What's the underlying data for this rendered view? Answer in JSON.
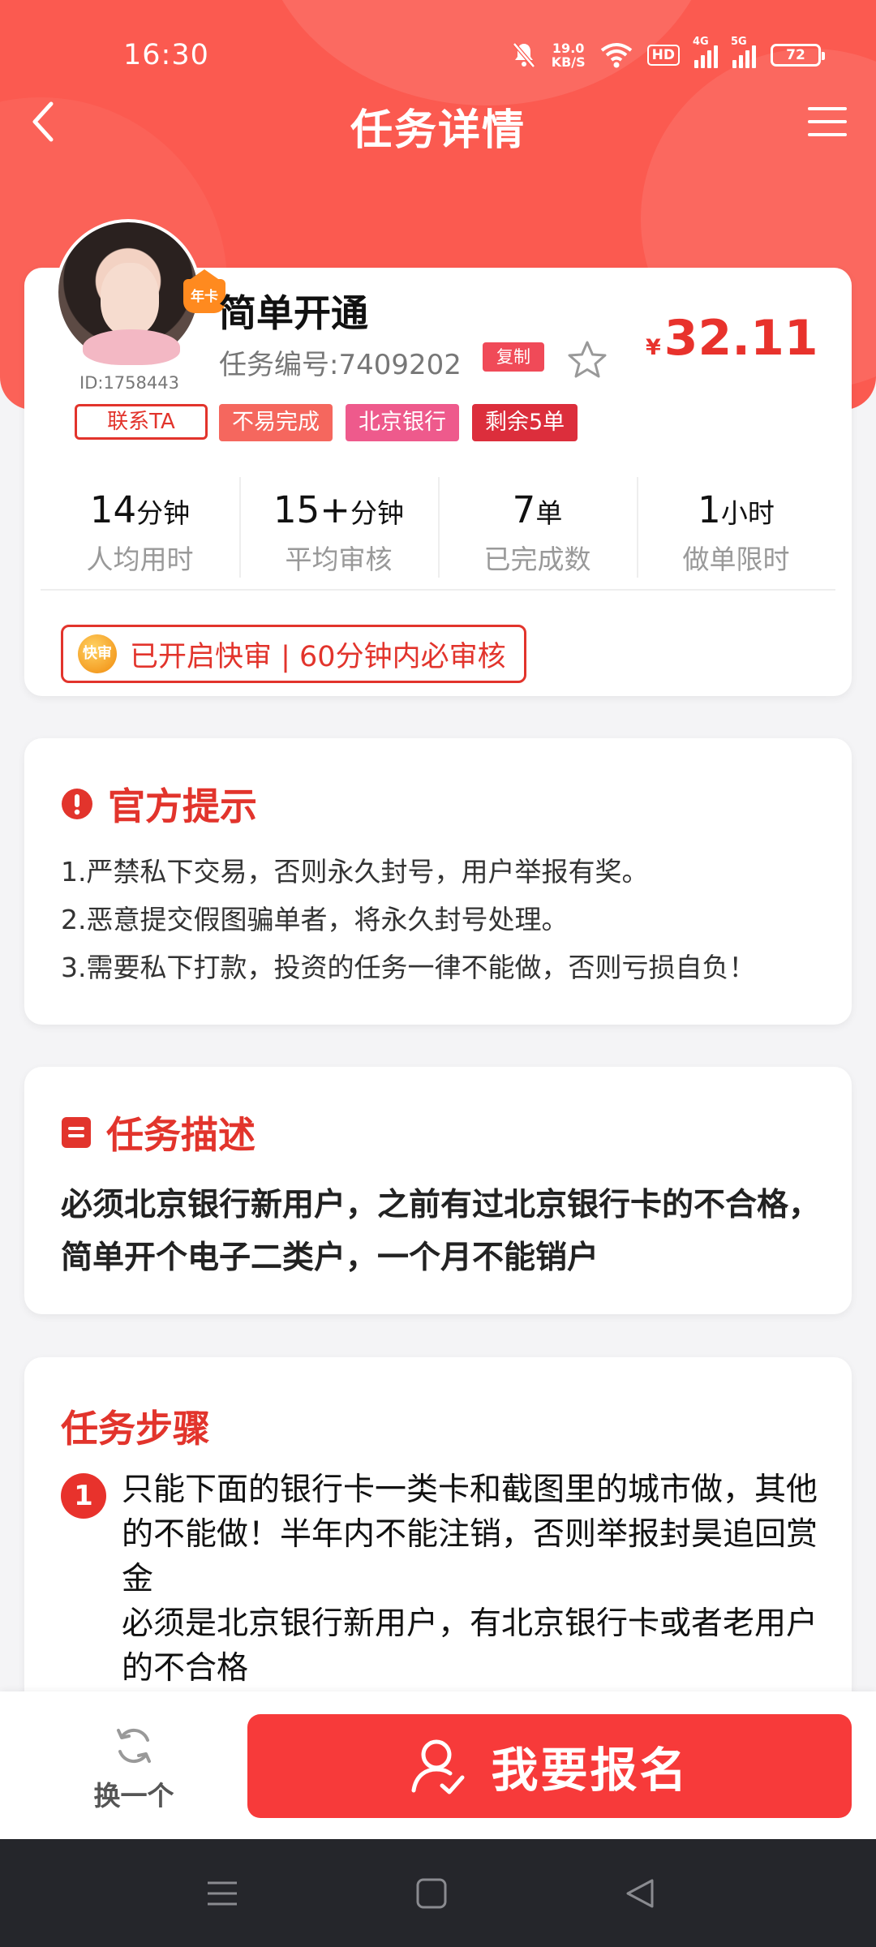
{
  "status_bar": {
    "time": "16:30",
    "net_speed_value": "19.0",
    "net_speed_unit": "KB/S",
    "hd_label": "HD",
    "signal_1_label": "4G",
    "signal_2_label": "5G",
    "battery": "72"
  },
  "nav": {
    "title": "任务详情"
  },
  "task": {
    "title": "简单开通",
    "task_no": "任务编号:7409202",
    "copy_label": "复制",
    "price_currency": "¥",
    "price_value": "32.11",
    "user_id": "ID:1758443",
    "contact_label": "联系TA",
    "vip_label": "年卡",
    "tags": [
      "不易完成",
      "北京银行",
      "剩余5单"
    ],
    "stats": [
      {
        "value": "14",
        "unit": "分钟",
        "label": "人均用时"
      },
      {
        "value": "15+",
        "unit": "分钟",
        "label": "平均审核"
      },
      {
        "value": "7",
        "unit": "单",
        "label": "已完成数"
      },
      {
        "value": "1",
        "unit": "小时",
        "label": "做单限时"
      }
    ],
    "fast_review_icon": "快审",
    "fast_review_text": "已开启快审 | 60分钟内必审核"
  },
  "notice": {
    "title": "官方提示",
    "lines": [
      "1.严禁私下交易，否则永久封号，用户举报有奖。",
      "2.恶意提交假图骗单者，将永久封号处理。",
      "3.需要私下打款，投资的任务一律不能做，否则亏损自负！"
    ]
  },
  "description": {
    "title": "任务描述",
    "text": "必须北京银行新用户，之前有过北京银行卡的不合格，简单开个电子二类户，一个月不能销户"
  },
  "steps": {
    "title": "任务步骤",
    "items": [
      {
        "num": "1",
        "line1": "只能下面的银行卡一类卡和截图里的城市做，其他的不能做！半年内不能注销，否则举报封昊追回赏金",
        "line2": "必须是北京银行新用户，有北京银行卡或者老用户的不合格"
      }
    ]
  },
  "actions": {
    "switch_label": "换一个",
    "signup_label": "我要报名"
  },
  "colors": {
    "header_red": "#fb5a50",
    "accent_red": "#e2342c",
    "signup_red": "#f73a3a"
  }
}
